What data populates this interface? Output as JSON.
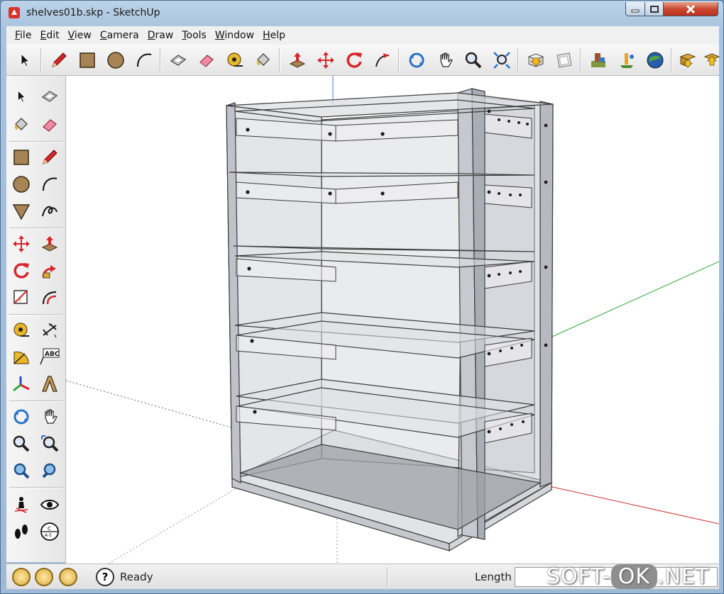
{
  "window": {
    "title": "shelves01b.skp - SketchUp",
    "minimize_icon": "minimize-icon",
    "maximize_icon": "maximize-icon",
    "close_icon": "close-icon"
  },
  "menu": {
    "items": [
      {
        "label": "File",
        "underline": "F",
        "rest": "ile"
      },
      {
        "label": "Edit",
        "underline": "E",
        "rest": "dit"
      },
      {
        "label": "View",
        "underline": "V",
        "rest": "iew"
      },
      {
        "label": "Camera",
        "underline": "C",
        "rest": "amera"
      },
      {
        "label": "Draw",
        "underline": "D",
        "rest": "raw"
      },
      {
        "label": "Tools",
        "underline": "T",
        "rest": "ools"
      },
      {
        "label": "Window",
        "underline": "W",
        "rest": "indow"
      },
      {
        "label": "Help",
        "underline": "H",
        "rest": "elp"
      }
    ]
  },
  "top_toolbar": {
    "icons": [
      "select-icon",
      "pencil-icon",
      "rectangle-icon",
      "circle-icon",
      "arc-icon",
      "make-component-icon",
      "eraser-icon",
      "tape-measure-icon",
      "paint-bucket-icon",
      "push-pull-icon",
      "move-icon",
      "rotate-icon",
      "follow-me-icon",
      "orbit-icon",
      "pan-icon",
      "zoom-icon",
      "zoom-extents-icon",
      "get-models-icon",
      "share-model-icon",
      "components-icon",
      "place-model-icon",
      "google-earth-icon",
      "previous-view-icon",
      "next-view-icon"
    ]
  },
  "left_toolbar": {
    "icons": [
      "select-icon",
      "make-component-icon",
      "paint-bucket-icon",
      "eraser-icon",
      "rectangle-icon",
      "pencil-icon",
      "circle-icon",
      "arc-icon",
      "polygon-icon",
      "freehand-icon",
      "move-icon",
      "push-pull-icon",
      "rotate-icon",
      "follow-me-icon",
      "scale-icon",
      "offset-icon",
      "tape-measure-icon",
      "dimension-icon",
      "protractor-icon",
      "text-icon",
      "axes-icon",
      "3d-text-icon",
      "orbit-icon",
      "pan-icon",
      "zoom-icon",
      "zoom-window-icon",
      "previous-icon",
      "zoom-extents-icon",
      "position-camera-icon",
      "look-around-icon",
      "walk-icon",
      "section-plane-icon"
    ],
    "text_tool_label": "ABC",
    "section_label_a": "C",
    "section_label_b": "A-5"
  },
  "status": {
    "text": "Ready",
    "length_label": "Length",
    "length_value": "",
    "help_icon_glyph": "?"
  },
  "watermark": {
    "prefix": "SOFT-",
    "mid": "OK",
    "suffix": ".NET"
  },
  "colors": {
    "red_axis": "#d03030",
    "green_axis": "#2fa83a",
    "blue_axis": "#5b6fd0",
    "model_stroke": "#3c3c3c",
    "model_fill": "#c9ccd3",
    "accent_red": "#d6262b"
  }
}
